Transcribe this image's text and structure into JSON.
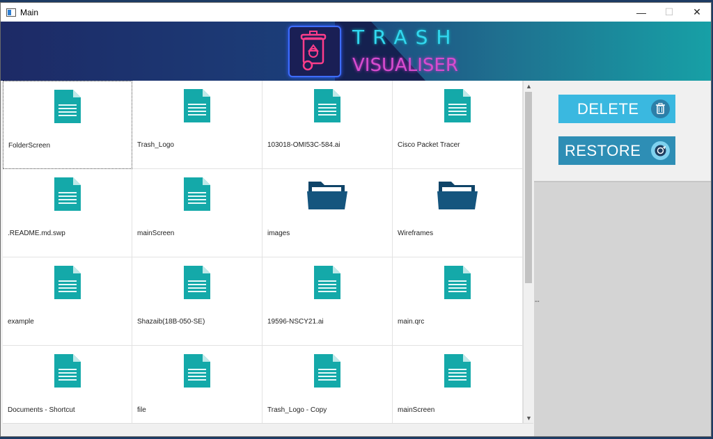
{
  "window": {
    "title": "Main",
    "minimize": "—",
    "maximize": "☐",
    "close": "✕"
  },
  "header": {
    "title_line1": "TRASH",
    "title_line2": "VISUALISER"
  },
  "actions": {
    "delete_label": "DELETE",
    "restore_label": "RESTORE"
  },
  "splitter": "--",
  "items": [
    {
      "name": "FolderScreen",
      "type": "file"
    },
    {
      "name": "Trash_Logo",
      "type": "file"
    },
    {
      "name": "103018-OMI53C-584.ai",
      "type": "file"
    },
    {
      "name": "Cisco Packet Tracer",
      "type": "file"
    },
    {
      "name": ".README.md.swp",
      "type": "file"
    },
    {
      "name": "mainScreen",
      "type": "file"
    },
    {
      "name": "images",
      "type": "folder"
    },
    {
      "name": "Wireframes",
      "type": "folder"
    },
    {
      "name": "example",
      "type": "file"
    },
    {
      "name": "Shazaib(18B-050-SE)",
      "type": "file"
    },
    {
      "name": "19596-NSCY21.ai",
      "type": "file"
    },
    {
      "name": "main.qrc",
      "type": "file"
    },
    {
      "name": "Documents - Shortcut",
      "type": "file"
    },
    {
      "name": "file",
      "type": "file"
    },
    {
      "name": "Trash_Logo - Copy",
      "type": "file"
    },
    {
      "name": "mainScreen",
      "type": "file"
    }
  ],
  "colors": {
    "file_icon": "#14a9a9",
    "folder_icon": "#15557e",
    "delete_button": "#3ab8e0",
    "restore_button": "#2e8eb5"
  }
}
